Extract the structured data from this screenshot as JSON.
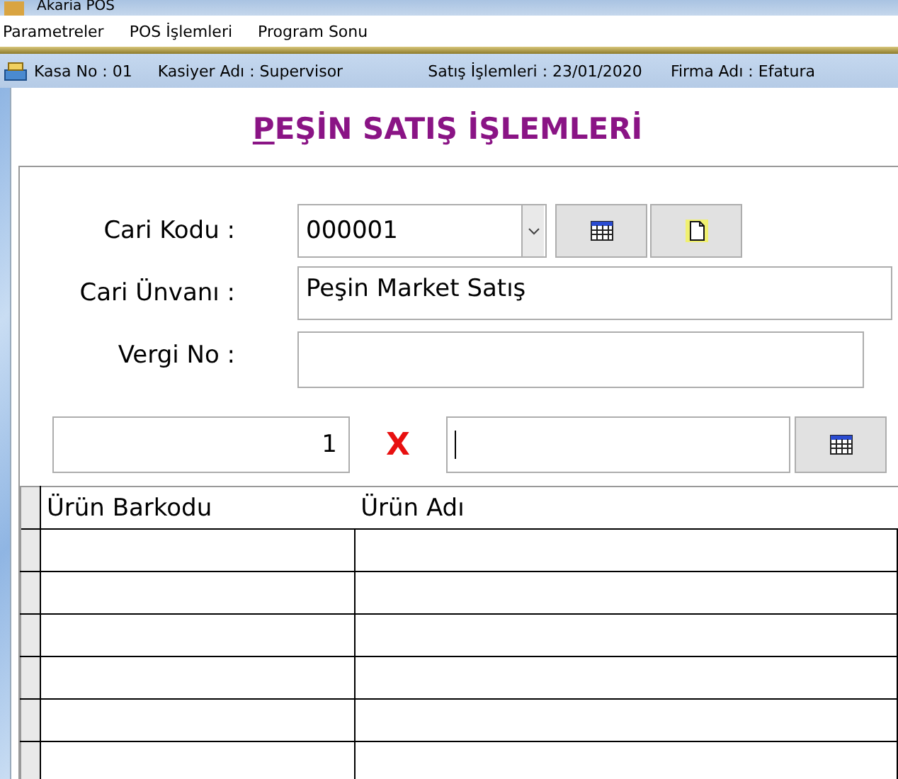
{
  "window": {
    "title": "Akaria POS"
  },
  "menu": [
    "Parametreler",
    "POS İşlemleri",
    "Program Sonu"
  ],
  "status_bar": [
    "Kasa No : 01",
    "Kasiyer Adı : Supervisor",
    "Satış İşlemleri : 23/01/2020",
    "Firma Adı : Efatura"
  ],
  "heading": "PEŞİN SATIŞ İŞLEMLERİ",
  "form": {
    "cari_kodu": {
      "label": "Cari Kodu :",
      "value": "000001"
    },
    "cari_unvani": {
      "label": "Cari Ünvanı :",
      "value": "Peşin Market Satış"
    },
    "vergi_no": {
      "label": "Vergi No :"
    }
  },
  "entry": {
    "quantity": "1",
    "multiply": "X"
  },
  "table": {
    "columns": [
      "Ürün Barkodu",
      "Ürün Adı"
    ]
  }
}
